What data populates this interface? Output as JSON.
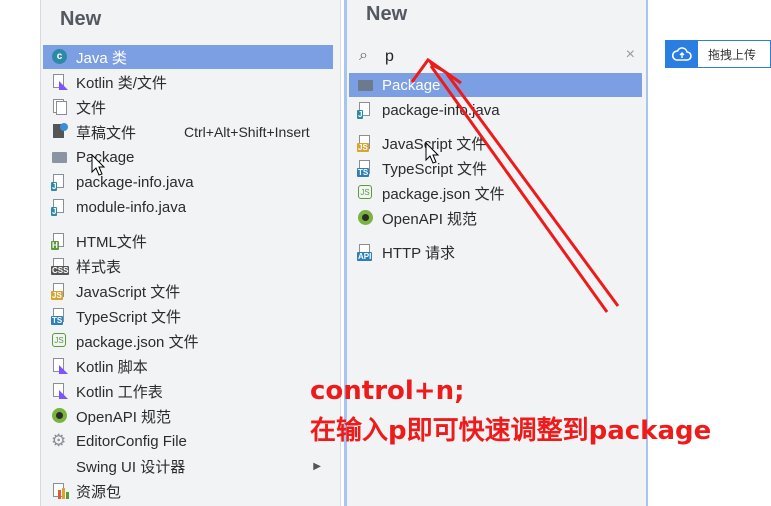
{
  "left_panel": {
    "title": "New",
    "items": [
      {
        "label": "Java 类",
        "icon": "java-class-icon"
      },
      {
        "label": "Kotlin 类/文件",
        "icon": "kotlin-file-icon"
      },
      {
        "label": "文件",
        "icon": "file-icon"
      },
      {
        "label": "草稿文件",
        "icon": "scratch-file-icon",
        "shortcut": "Ctrl+Alt+Shift+Insert"
      },
      {
        "label": "Package",
        "icon": "package-folder-icon"
      },
      {
        "label": "package-info.java",
        "icon": "java-file-icon"
      },
      {
        "label": "module-info.java",
        "icon": "java-file-icon"
      },
      {
        "label": "HTML文件",
        "icon": "html-file-icon"
      },
      {
        "label": "样式表",
        "icon": "css-file-icon"
      },
      {
        "label": "JavaScript 文件",
        "icon": "js-file-icon"
      },
      {
        "label": "TypeScript 文件",
        "icon": "ts-file-icon"
      },
      {
        "label": "package.json 文件",
        "icon": "nodejs-icon"
      },
      {
        "label": "Kotlin 脚本",
        "icon": "kotlin-file-icon"
      },
      {
        "label": "Kotlin 工作表",
        "icon": "kotlin-file-icon"
      },
      {
        "label": "OpenAPI 规范",
        "icon": "openapi-icon"
      },
      {
        "label": "EditorConfig File",
        "icon": "gear-icon"
      },
      {
        "label": "Swing UI 设计器",
        "icon": "none"
      },
      {
        "label": "资源包",
        "icon": "resource-bundle-icon"
      }
    ]
  },
  "right_panel": {
    "title": "New",
    "search": {
      "value": "p",
      "placeholder": ""
    },
    "items": [
      {
        "label": "Package",
        "icon": "package-folder-icon"
      },
      {
        "label": "package-info.java",
        "icon": "java-file-icon"
      },
      {
        "label": "JavaScript 文件",
        "icon": "js-file-icon"
      },
      {
        "label": "TypeScript 文件",
        "icon": "ts-file-icon"
      },
      {
        "label": "package.json 文件",
        "icon": "nodejs-icon"
      },
      {
        "label": "OpenAPI 规范",
        "icon": "openapi-icon"
      },
      {
        "label": "HTTP 请求",
        "icon": "api-file-icon"
      }
    ]
  },
  "upload_button": {
    "label": "拖拽上传"
  },
  "annotation": {
    "line1": "control+n;",
    "line2": "在输入p即可快速调整到package"
  },
  "colors": {
    "selection": "#7c9ee3",
    "annotation": "#ee1b1b",
    "upload_accent": "#2a7de1"
  }
}
